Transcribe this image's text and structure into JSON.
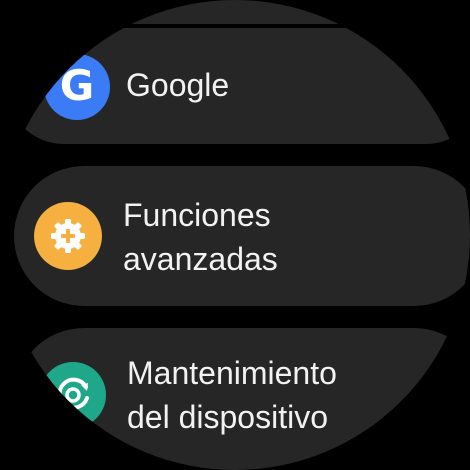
{
  "menu": {
    "items": [
      {
        "label": "Google",
        "icon": "google-g-icon",
        "icon_color": "#3b7bf6"
      },
      {
        "label_line1": "Funciones",
        "label_line2": "avanzadas",
        "icon": "gear-plus-icon",
        "icon_color": "#f5b040"
      },
      {
        "label_line1": "Mantenimiento",
        "label_line2": "del dispositivo",
        "icon": "device-care-icon",
        "icon_color": "#1fa789"
      }
    ]
  },
  "colors": {
    "background": "#000000",
    "row_background": "#262626",
    "text": "#f2f2f2"
  }
}
